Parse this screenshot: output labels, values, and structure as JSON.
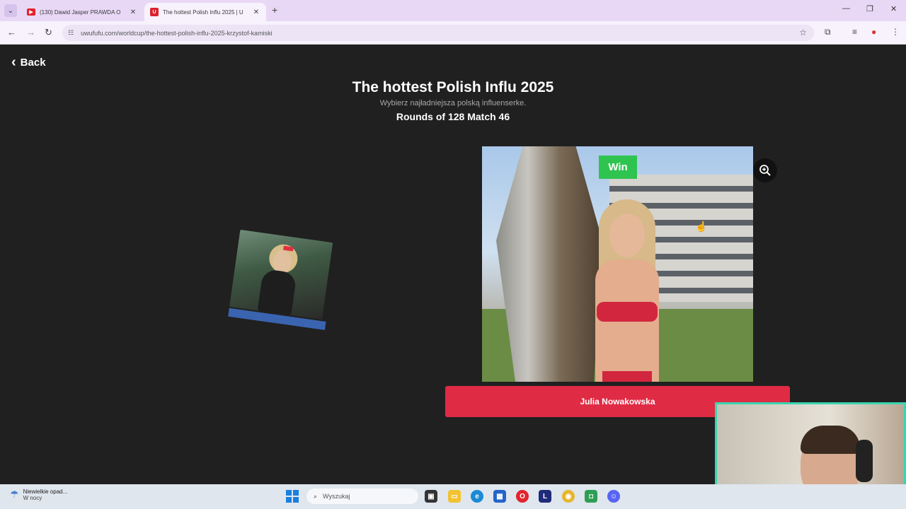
{
  "browser": {
    "tabs": [
      {
        "title": "(130) Dawid Jasper PRAWDA O",
        "active": false
      },
      {
        "title": "The hottest Polish Influ 2025 | U",
        "active": true
      }
    ],
    "url": "uwufufu.com/worldcup/the-hottest-polish-influ-2025-krzystof-kamiski"
  },
  "page": {
    "back_label": "Back",
    "title": "The hottest Polish Influ 2025",
    "subtitle": "Wybierz najładniejsza polską influenserke.",
    "round_info": "Rounds of 128 Match 46",
    "win_label": "Win",
    "winner_name": "Julia Nowakowska"
  },
  "taskbar": {
    "weather_line1": "Niewielkie opad...",
    "weather_line2": "W nocy",
    "search_placeholder": "Wyszukaj",
    "apps": [
      "file-explorer-icon",
      "folder-icon",
      "edge-icon",
      "store-icon",
      "opera-icon",
      "l-app-icon",
      "chrome-icon",
      "android-icon",
      "discord-icon"
    ]
  },
  "colors": {
    "page_bg": "#202020",
    "win_green": "#2ec44f",
    "name_button_red": "#e02b45",
    "webcam_border": "#3ad4b0"
  }
}
